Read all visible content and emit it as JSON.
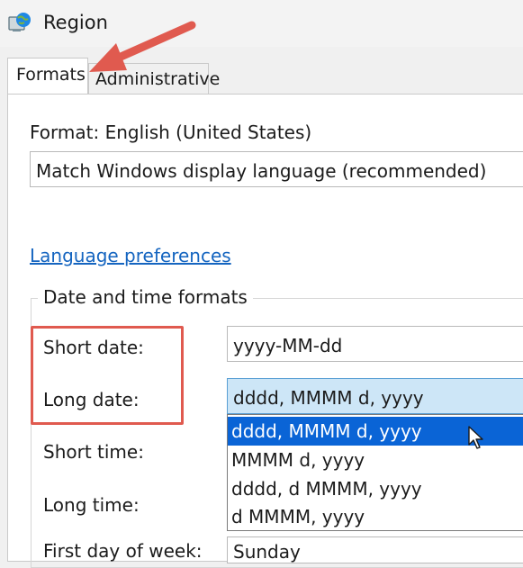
{
  "window": {
    "title": "Region",
    "icon": "globe-region-icon"
  },
  "tabs": [
    {
      "label": "Formats",
      "selected": true
    },
    {
      "label": "Administrative",
      "selected": false
    }
  ],
  "formats": {
    "format_label": "Format: English (United States)",
    "format_value": "Match Windows display language (recommended)",
    "language_link": "Language preferences",
    "group_label": "Date and time formats",
    "rows": {
      "short_date": {
        "label": "Short date:",
        "value": "yyyy-MM-dd"
      },
      "long_date": {
        "label": "Long date:",
        "value": "dddd, MMMM d, yyyy"
      },
      "short_time": {
        "label": "Short time:"
      },
      "long_time": {
        "label": "Long time:"
      },
      "cutoff_label": "First day of week:",
      "cutoff_value": "Sunday"
    },
    "long_date_options": [
      {
        "label": "dddd, MMMM d, yyyy",
        "selected": true
      },
      {
        "label": "MMMM d, yyyy",
        "selected": false
      },
      {
        "label": "dddd, d MMMM, yyyy",
        "selected": false
      },
      {
        "label": "d MMMM, yyyy",
        "selected": false
      }
    ]
  },
  "annotations": {
    "arrow_color": "#e05a4f",
    "highlight_color": "#e05a4f"
  },
  "colors": {
    "link": "#1565c0",
    "selection": "#0a64d6",
    "focused_field": "#cde6f7"
  }
}
